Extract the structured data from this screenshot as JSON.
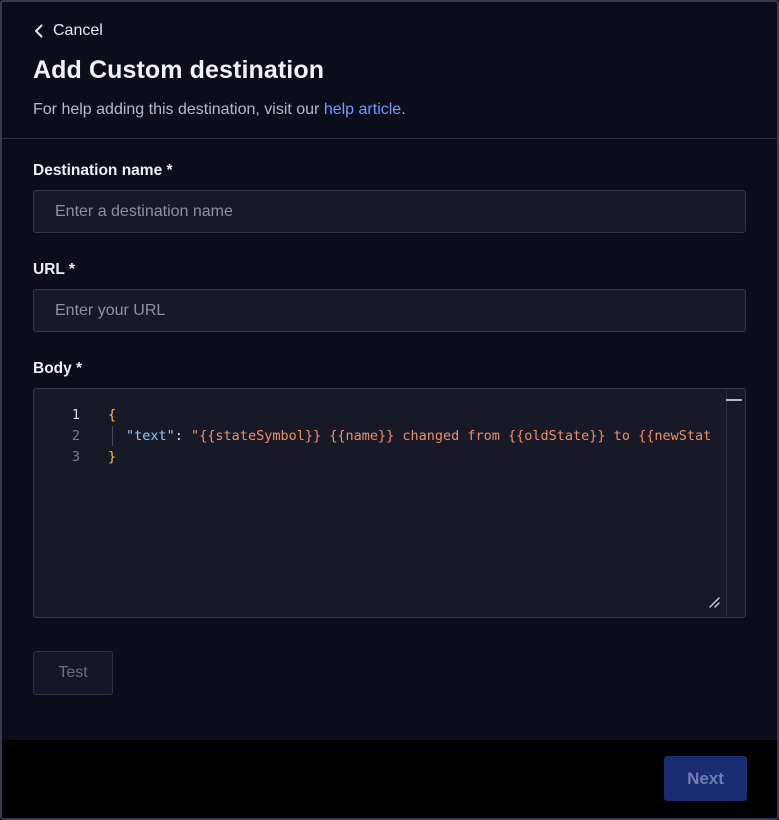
{
  "header": {
    "cancel_label": "Cancel",
    "title": "Add Custom destination",
    "subtitle_prefix": "For help adding this destination, visit our ",
    "help_link": "help article",
    "subtitle_suffix": "."
  },
  "form": {
    "name_label": "Destination name *",
    "name_placeholder": "Enter a destination name",
    "url_label": "URL *",
    "url_placeholder": "Enter your URL",
    "body_label": "Body *"
  },
  "editor": {
    "line_numbers": [
      "1",
      "2",
      "3"
    ],
    "open_brace": "{",
    "key": "\"text\"",
    "colon": ": ",
    "value": "\"{{stateSymbol}} {{name}} changed from {{oldState}} to {{newStat",
    "close_brace": "}"
  },
  "actions": {
    "test_label": "Test",
    "next_label": "Next"
  },
  "icons": {
    "cancel": "chevron-left-icon",
    "resize": "resize-handle-icon"
  },
  "colors": {
    "link": "#6d9bff",
    "primary_disabled": "#1b2d72",
    "background": "#0c0d1a"
  }
}
